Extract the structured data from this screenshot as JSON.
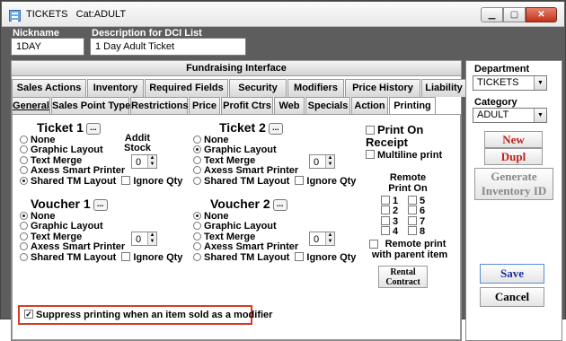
{
  "window": {
    "title": "TICKETS",
    "subtitle": "Cat:ADULT"
  },
  "header": {
    "nickname_label": "Nickname",
    "nickname_value": "1DAY",
    "description_label": "Description for DCI List",
    "description_value": "1 Day Adult Ticket"
  },
  "fundraising_label": "Fundraising Interface",
  "tabs_row1": [
    "Sales Actions",
    "Inventory",
    "Required Fields",
    "Security",
    "Modifiers",
    "Price History",
    "Liability"
  ],
  "tabs_row2": [
    "General",
    "Sales Point Type",
    "Restrictions",
    "Price",
    "Profit Ctrs",
    "Web",
    "Specials",
    "Action",
    "Printing"
  ],
  "printing": {
    "ticket1": {
      "title": "Ticket 1",
      "dots": "...",
      "selected": "Shared TM Layout"
    },
    "ticket2": {
      "title": "Ticket 2",
      "dots": "...",
      "selected": "Graphic Layout"
    },
    "voucher1": {
      "title": "Voucher 1",
      "dots": "...",
      "selected": "None"
    },
    "voucher2": {
      "title": "Voucher 2",
      "dots": "...",
      "selected": "None"
    },
    "options": [
      "None",
      "Graphic Layout",
      "Text Merge",
      "Axess Smart Printer",
      "Shared TM Layout"
    ],
    "ignore_qty": "Ignore Qty",
    "addit_stock_label": "Addit\nStock",
    "spin_value": "0",
    "print_on_receipt": "Print On Receipt",
    "multiline_print": "Multiline print",
    "remote_print_on": "Remote Print On",
    "remote_numbers": [
      "1",
      "5",
      "2",
      "6",
      "3",
      "7",
      "4",
      "8"
    ],
    "remote_with_parent": "Remote print with parent item",
    "rental_contract": "Rental Contract",
    "suppress_label": "Suppress printing when an item sold as a modifier",
    "suppress_checked": true
  },
  "side": {
    "department_label": "Department",
    "department_value": "TICKETS",
    "category_label": "Category",
    "category_value": "ADULT",
    "new_label": "New",
    "dupl_label": "Dupl",
    "generate_label": "Generate Inventory ID",
    "save_label": "Save",
    "cancel_label": "Cancel"
  },
  "colors": {
    "accent_red": "#c0221b",
    "save_blue": "#1a2f9a",
    "highlight_red": "#d93a2a"
  }
}
